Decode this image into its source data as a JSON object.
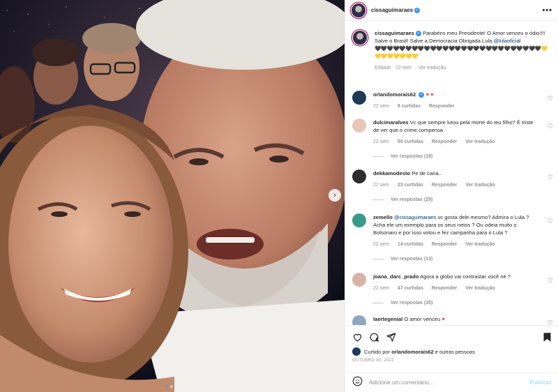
{
  "post": {
    "username": "cissaguimaraes",
    "caption": "Parabéns meu Presidente! O Amor venceu o ódio!!!! Salve o Brasil! Salve a Democracia Obrigada Lula",
    "caption_mention": "@lulaoficial",
    "caption_hearts": "🖤🖤🖤🖤🖤🖤🖤🖤🖤🖤🖤🖤🖤🖤🖤🖤🖤🖤🖤🖤🖤🖤🖤🖤🖤🖤🖤💛💛💛💛💛💛💛💛",
    "caption_meta_edited": "Editado · 22 sem",
    "caption_meta_translate": "Ver tradução"
  },
  "comments": [
    {
      "user": "orlandomorais62",
      "text": "",
      "emoji": "♥ ♥",
      "age": "22 sem",
      "likes": "9 curtidas",
      "reply": "Responder",
      "translate": "",
      "replies": "",
      "avatar_color": "#1c3c56"
    },
    {
      "user": "dulcimaralves",
      "text": "Vc que sempre lutou pela morte do teu filho? É triste de ver que o crime compensa",
      "emoji": "",
      "age": "22 sem",
      "likes": "50 curtidas",
      "reply": "Responder",
      "translate": "Ver tradução",
      "replies": "Ver respostas (18)",
      "avatar_color": "#e8c7b6"
    },
    {
      "user": "dekkamodesto",
      "text": "Pe de cana..",
      "emoji": "",
      "age": "22 sem",
      "likes": "23 curtidas",
      "reply": "Responder",
      "translate": "Ver tradução",
      "replies": "Ver respostas (29)",
      "avatar_color": "#2e2e2e"
    },
    {
      "user": "zemello",
      "mention": "@cissaguimaraes",
      "text": "vc gosta dele mesmo? Admira o Lula ? Acha ele um exemplo para os seus netos ? Ou odeia muito o Bolsonaro e por isso votou e fez campanha para o Lula ?",
      "emoji": "",
      "age": "22 sem",
      "likes": "14 curtidas",
      "reply": "Responder",
      "translate": "Ver tradução",
      "replies": "Ver respostas (13)",
      "avatar_color": "#3a9a8a"
    },
    {
      "user": "joana_darc_prado",
      "text": "Agora a globo vai contrastar você né ?",
      "emoji": "",
      "age": "22 sem",
      "likes": "47 curtidas",
      "reply": "Responder",
      "translate": "Ver tradução",
      "replies": "Ver respostas (35)",
      "avatar_color": "#d8b4a4"
    },
    {
      "user": "laertegenial",
      "text": "O amor venceu",
      "emoji": "♥",
      "age": "",
      "likes": "",
      "reply": "",
      "translate": "",
      "replies": "",
      "avatar_color": "#8fa6c0"
    }
  ],
  "actions": {
    "liked_prefix": "Curtido por",
    "liked_user": "orlandomorais62",
    "liked_suffix": "e outras pessoas",
    "date": "OUTUBRO 30, 2022",
    "comment_placeholder": "Adicione um comentário...",
    "post_label": "Publicar",
    "more_label": "•••",
    "verified_mark": "✓",
    "next_arrow": "›"
  },
  "colors": {
    "accent": "#0095f6",
    "heart": "#ed4956",
    "muted": "#8e8e8e"
  }
}
